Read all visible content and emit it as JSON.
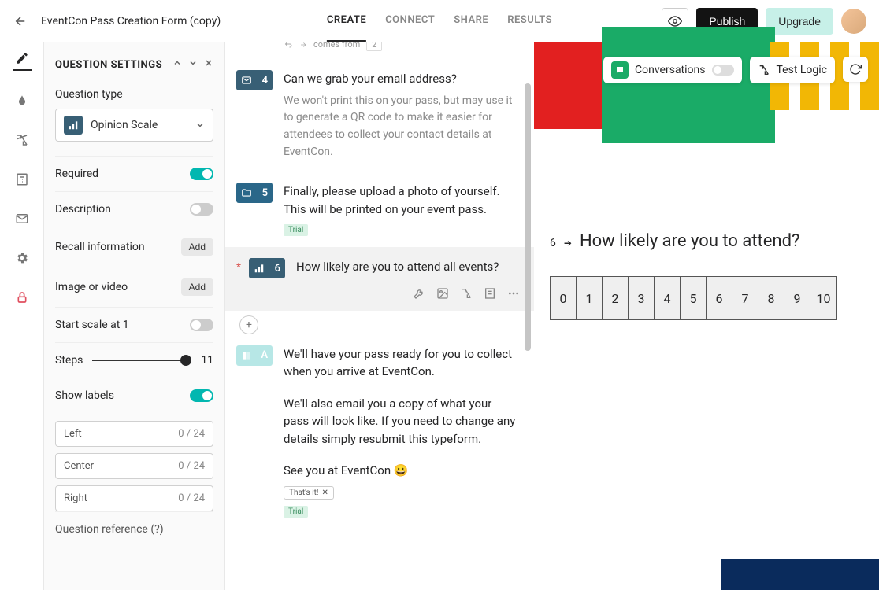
{
  "header": {
    "title": "EventCon Pass Creation Form (copy)",
    "tabs": {
      "create": "CREATE",
      "connect": "CONNECT",
      "share": "SHARE",
      "results": "RESULTS"
    },
    "publish": "Publish",
    "upgrade": "Upgrade"
  },
  "settings": {
    "heading": "QUESTION SETTINGS",
    "qtype_label": "Question type",
    "qtype_value": "Opinion Scale",
    "required_label": "Required",
    "description_label": "Description",
    "recall_label": "Recall information",
    "recall_btn": "Add",
    "media_label": "Image or video",
    "media_btn": "Add",
    "startat1_label": "Start scale at 1",
    "steps_label": "Steps",
    "steps_value": "11",
    "showlabels_label": "Show labels",
    "labels": {
      "left": {
        "ph": "Left",
        "count": "0 / 24"
      },
      "center": {
        "ph": "Center",
        "count": "0 / 24"
      },
      "right": {
        "ph": "Right",
        "count": "0 / 24"
      }
    },
    "qref_label": "Question reference (?)"
  },
  "logic": {
    "comes_from": "comes from",
    "comes_from_num": "2"
  },
  "questions": [
    {
      "num": "4",
      "type": "email",
      "title": "Can we grab your email address?",
      "desc": "We won't print this on your pass, but may use it to generate a QR code to make it easier for attendees to collect your contact details at EventCon."
    },
    {
      "num": "5",
      "type": "file",
      "title": "Finally, please upload a photo of yourself. This will be printed on your event pass.",
      "trial": "Trial"
    },
    {
      "num": "6",
      "type": "scale",
      "title": "How likely are you to attend all events?",
      "required": true,
      "selected": true
    },
    {
      "num": "A",
      "type": "end",
      "title": "We'll have your pass ready for you to collect when you arrive at EventCon.",
      "body2": "We'll also email you a copy of what your pass will look like. If you need to change any details simply resubmit this typeform.",
      "body3": "See you at EventCon 😀",
      "thatsit": "That's it!",
      "trial": "Trial"
    }
  ],
  "preview": {
    "conversations": "Conversations",
    "testlogic": "Test Logic",
    "qnum": "6",
    "qtext": "How likely are you to attend?",
    "scale": [
      "0",
      "1",
      "2",
      "3",
      "4",
      "5",
      "6",
      "7",
      "8",
      "9",
      "10"
    ]
  }
}
